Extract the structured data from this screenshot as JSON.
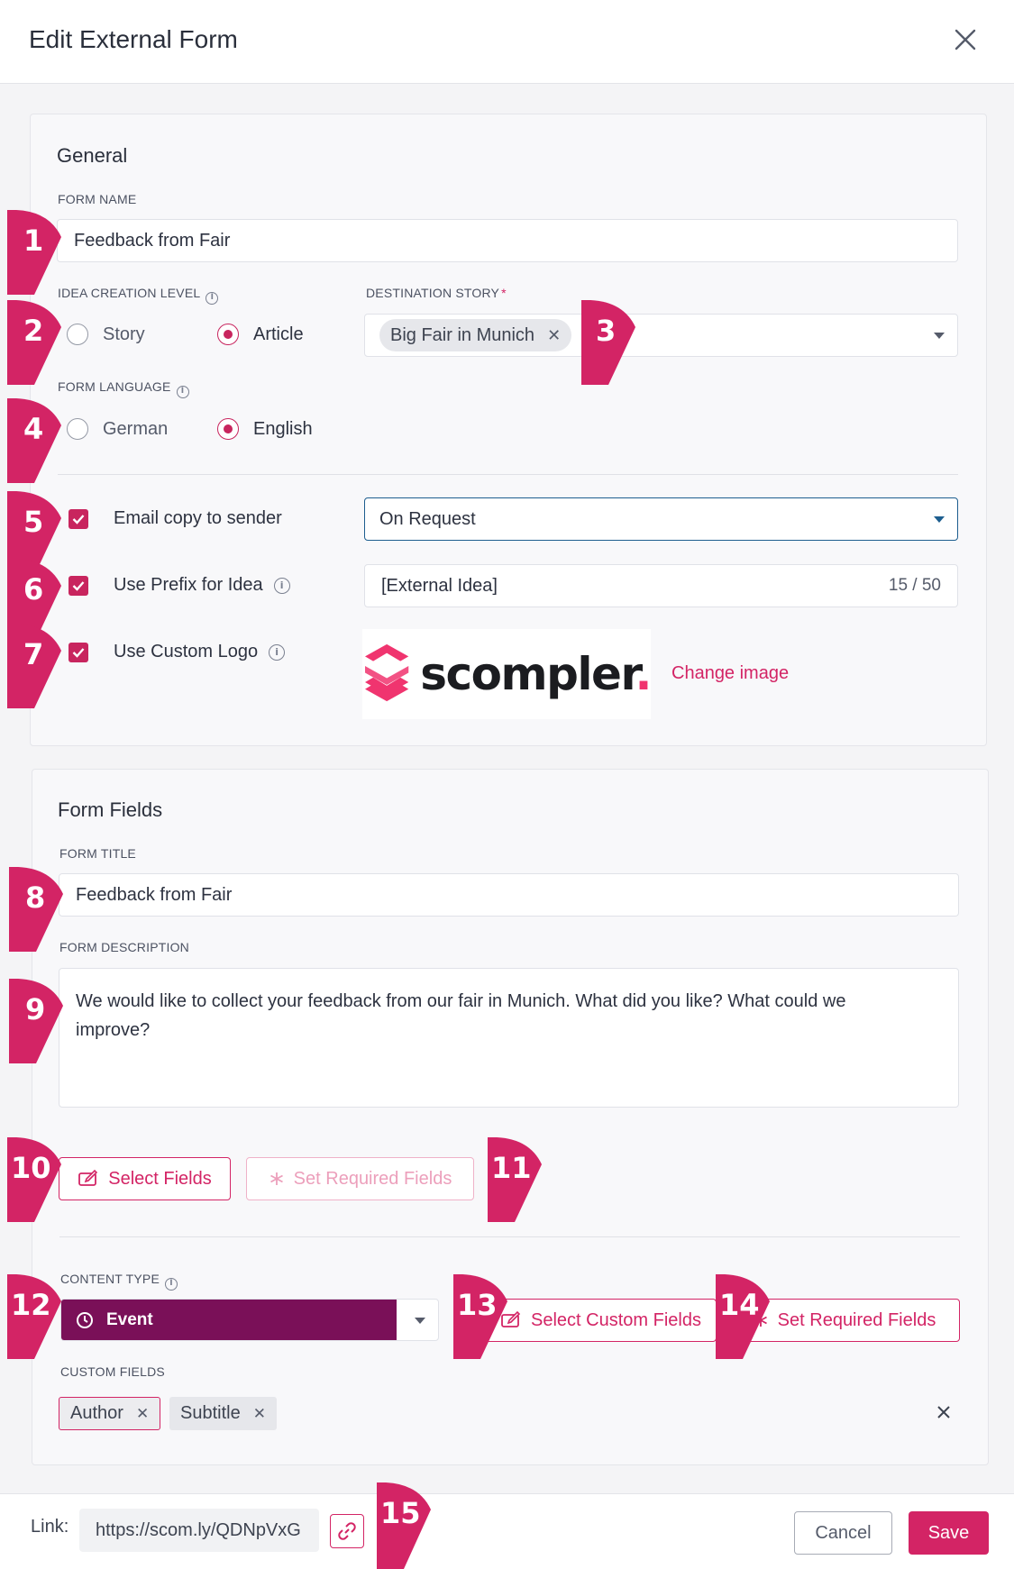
{
  "header": {
    "title": "Edit External Form"
  },
  "general": {
    "title": "General",
    "form_name_label": "FORM NAME",
    "form_name_value": "Feedback from Fair",
    "idea_level_label": "IDEA CREATION LEVEL",
    "idea_level_options": [
      "Story",
      "Article"
    ],
    "idea_level_selected": "Article",
    "destination_label": "DESTINATION STORY",
    "destination_required": "*",
    "destination_tag": "Big Fair in Munich",
    "language_label": "FORM LANGUAGE",
    "language_options": [
      "German",
      "English"
    ],
    "language_selected": "English",
    "email_copy_label": "Email copy to sender",
    "email_copy_checked": true,
    "email_copy_mode": "On Request",
    "prefix_label": "Use Prefix for Idea",
    "prefix_checked": true,
    "prefix_value": "[External Idea]",
    "prefix_counter": "15 / 50",
    "logo_label": "Use Custom Logo",
    "logo_checked": true,
    "logo_text": "scompler",
    "logo_dot": ".",
    "change_image": "Change image"
  },
  "form_fields": {
    "title": "Form Fields",
    "form_title_label": "FORM TITLE",
    "form_title_value": "Feedback from Fair",
    "form_desc_label": "FORM DESCRIPTION",
    "form_desc_value": "We would like to collect your feedback from our fair in Munich. What did you like? What could we improve?",
    "select_fields": "Select Fields",
    "set_required_fields_disabled": "Set Required Fields",
    "content_type_label": "CONTENT TYPE",
    "content_type_value": "Event",
    "select_custom_fields": "Select Custom Fields",
    "set_required_fields": "Set Required Fields",
    "custom_fields_label": "CUSTOM FIELDS",
    "custom_fields": [
      "Author",
      "Subtitle"
    ]
  },
  "footer": {
    "link_label": "Link:",
    "link_value": "https://scom.ly/QDNpVxG",
    "cancel": "Cancel",
    "save": "Save"
  },
  "markers": [
    "1",
    "2",
    "3",
    "4",
    "5",
    "6",
    "7",
    "8",
    "9",
    "10",
    "11",
    "12",
    "13",
    "14",
    "15"
  ],
  "colors": {
    "accent": "#d32465",
    "content_type": "#7a1058",
    "focus_border": "#1d5e8f"
  }
}
